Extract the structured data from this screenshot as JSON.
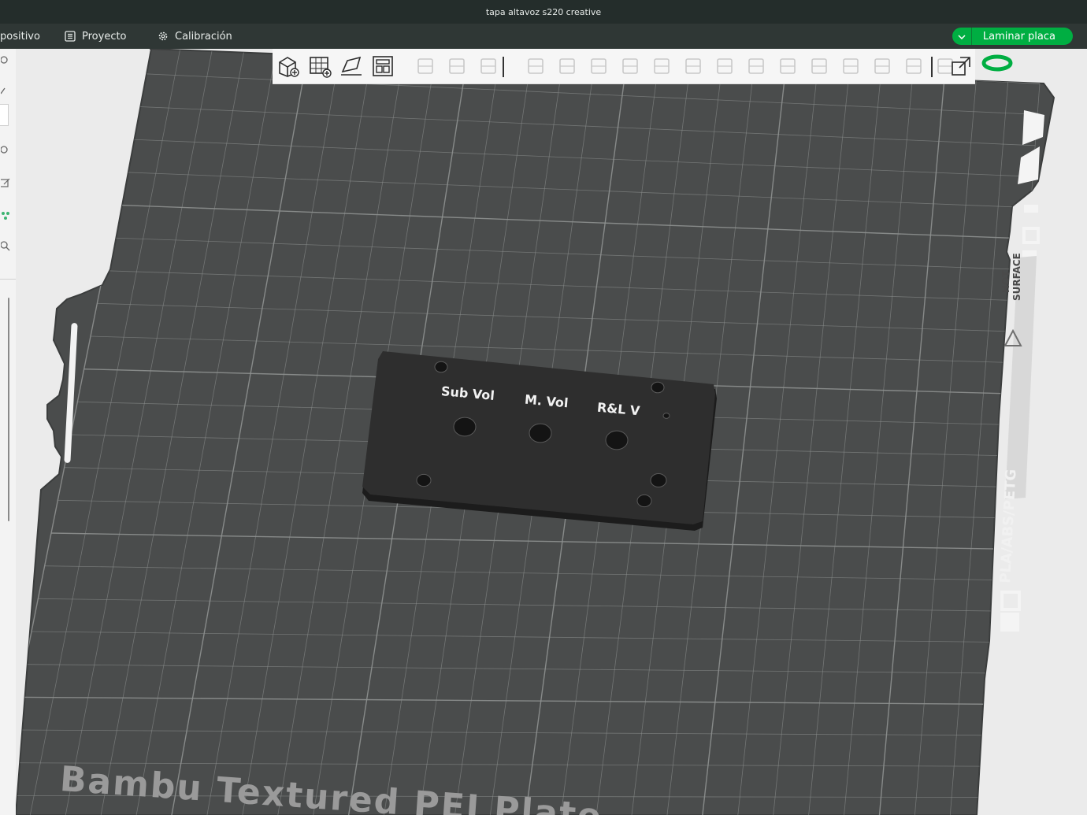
{
  "window": {
    "title": "tapa altavoz s220 creative"
  },
  "menubar": {
    "items": [
      {
        "label": "positivo",
        "icon": "monitor-icon"
      },
      {
        "label": "Proyecto",
        "icon": "project-list-icon"
      },
      {
        "label": "Calibración",
        "icon": "calibration-gear-icon"
      }
    ],
    "slice_button": "Laminar placa"
  },
  "toolbar": {
    "tools": [
      "add-cube-icon",
      "add-plate-icon",
      "auto-orient-icon",
      "arrange-icon",
      "copy-icon",
      "paste-icon",
      "delete-icon",
      "move-icon",
      "rotate-icon",
      "scale-icon",
      "lay-on-face-icon",
      "cut-icon",
      "split-objects-icon",
      "split-parts-icon",
      "support-paint-icon",
      "seam-paint-icon",
      "text-icon",
      "measure-icon",
      "assembly-icon",
      "brim-ear-icon",
      "view-toggle-icon",
      "export-view-icon",
      "filament-icon"
    ]
  },
  "sidepanel": {
    "icons": [
      "settings-icon",
      "edit-icon",
      "settings-icon",
      "edit-icon",
      "nodes-icon",
      "search-icon"
    ]
  },
  "plate": {
    "name": "Bambu Textured PEI Plate",
    "right_labels": {
      "hot": "HOT",
      "surface": "SURFACE",
      "materials": "PLA/ABS/PETG"
    }
  },
  "part": {
    "labels": [
      "Sub Vol",
      "M. Vol",
      "R&L V"
    ]
  },
  "colors": {
    "titlebar": "#242d2b",
    "menubar": "#2f3735",
    "accent_green": "#00ae42",
    "plate_surface": "#4a4c4c",
    "grid_line": "#8e9190",
    "part": "#2e2e2e"
  }
}
